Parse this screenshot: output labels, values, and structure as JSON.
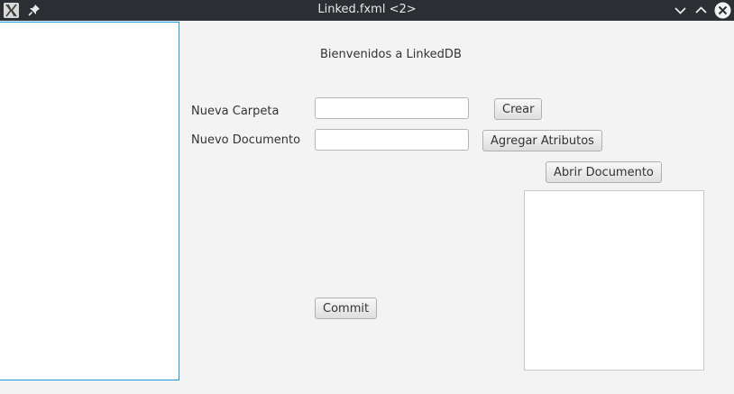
{
  "window": {
    "title": "Linked.fxml <2>"
  },
  "titlebar_icons": {
    "app": "x-app-icon",
    "pin": "pin-icon",
    "minimize": "chevron-down-icon",
    "maximize": "chevron-up-icon",
    "close": "close-icon"
  },
  "main": {
    "welcome": "Bienvenidos a LinkedDB",
    "new_folder_label": "Nueva Carpeta",
    "new_folder_value": "",
    "create_button": "Crear",
    "new_document_label": "Nuevo Documento",
    "new_document_value": "",
    "add_attributes_button": "Agregar Atributos",
    "open_document_button": "Abrir Documento",
    "commit_button": "Commit"
  },
  "colors": {
    "titlebar": "#2b2e32",
    "background": "#f3f3f3",
    "focus_border": "#1e9ad6"
  }
}
